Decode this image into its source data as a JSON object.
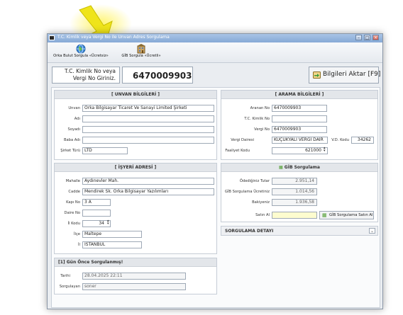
{
  "window": {
    "title": "T.C. Kimlik veya Vergi No ile Unvan Adres Sorgulama",
    "controls": [
      "–",
      "□",
      "×"
    ]
  },
  "toolbar": {
    "items": [
      {
        "label": "Orka Bulut Sorgula «Ücretsiz»",
        "icon": "globe-icon"
      },
      {
        "label": "GİB Sorgula «Ücretli»",
        "icon": "building-icon"
      }
    ]
  },
  "query": {
    "label": "T.C. Kimlik No veya Vergi No Giriniz.",
    "value": "6470009903",
    "transfer_button": "Bilgileri Aktar [F9]"
  },
  "unvan": {
    "title": "[ UNVAN BİLGİLERİ ]",
    "fields": [
      {
        "label": "Unvan",
        "value": "Orka Bilgisayar Ticaret Ve Sanayi Limited Şirketi"
      },
      {
        "label": "Adı",
        "value": ""
      },
      {
        "label": "Soyadı",
        "value": ""
      },
      {
        "label": "Baba Adı",
        "value": ""
      },
      {
        "label": "Şirket Türü",
        "value": "LTD"
      }
    ]
  },
  "isyeri": {
    "title": "[ İŞYERİ ADRESİ ]",
    "fields": [
      {
        "label": "Mahalle",
        "value": "Aydınevler Mah."
      },
      {
        "label": "Cadde",
        "value": "Mendirek Sk. Orka Bilgisayar Yazılımları"
      },
      {
        "label": "Kapı No",
        "value": "3 A"
      },
      {
        "label": "Daire No",
        "value": ""
      },
      {
        "label": "İl Kodu",
        "value": "34"
      },
      {
        "label": "İlçe",
        "value": "Maltepe"
      },
      {
        "label": "İl",
        "value": "İSTANBUL"
      }
    ]
  },
  "history": {
    "title": "[1] Gün Önce Sorgulanmış!",
    "fields": [
      {
        "label": "Tarihi",
        "value": "28.04.2025 22:11"
      },
      {
        "label": "Sorgulayan",
        "value": "soner"
      }
    ]
  },
  "arama": {
    "title": "[ ARAMA BİLGİLERİ ]",
    "fields": [
      {
        "label": "Aranan No",
        "value": "6470009903"
      },
      {
        "label": "T.C. Kimlik No",
        "value": ""
      },
      {
        "label": "Vergi No",
        "value": "6470009903"
      },
      {
        "label": "Vergi Dairesi",
        "value": "KÜÇÜKYALI VERGİ DAİR"
      },
      {
        "label": "Faaliyet Kodu",
        "value": "621000"
      }
    ],
    "vd_kodu_label": "V.D. Kodu",
    "vd_kodu_value": "34262"
  },
  "gib": {
    "title": "GİB Sorgulama",
    "fields": [
      {
        "label": "Ödediğiniz Tutar",
        "value": "2.951,14"
      },
      {
        "label": "GİB Sorgulama Ücretiniz",
        "value": "1.014,56"
      },
      {
        "label": "Bakiyeniz",
        "value": "1.936,58"
      }
    ],
    "buy_label": "Satın Al",
    "buy_value": "",
    "buy_button": "GİB Sorgulama Satın Al"
  },
  "detail": {
    "title": "SORGULAMA DETAYI"
  },
  "colors": {
    "titlebar": "#93b3dc",
    "highlight_field": "#fdfccf",
    "arrow": "#f2ea1e"
  }
}
